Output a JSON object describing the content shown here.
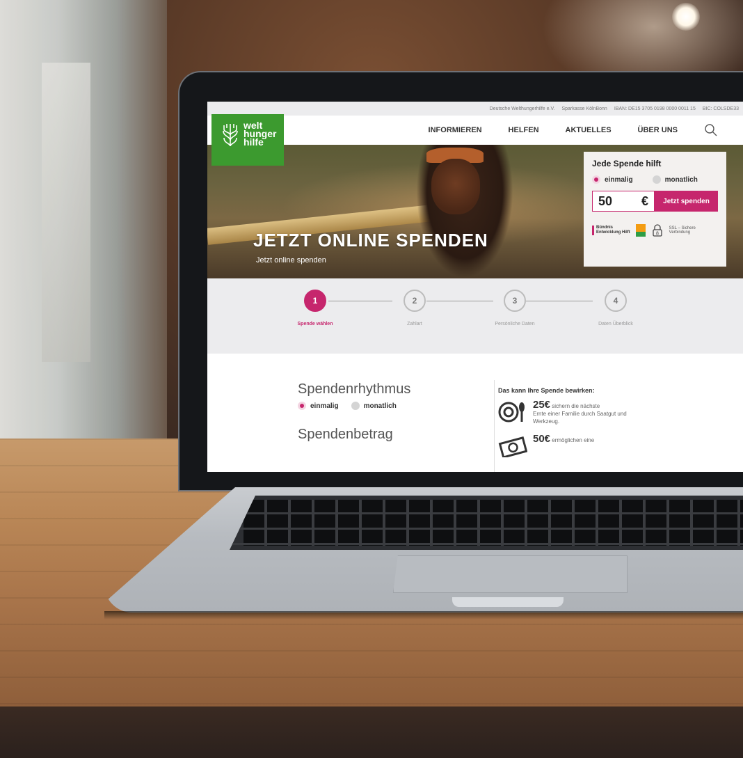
{
  "topbar": {
    "org": "Deutsche Welthungerhilfe e.V.",
    "bank": "Sparkasse KölnBonn",
    "iban": "IBAN: DE15 3705 0198 0000 0011 15",
    "bic": "BIC: COLSDE33"
  },
  "logo": {
    "line1": "welt",
    "line2": "hunger",
    "line3": "hilfe",
    "icon": "wheat-logo-icon"
  },
  "nav": {
    "items": [
      {
        "label": "INFORMIEREN"
      },
      {
        "label": "HELFEN"
      },
      {
        "label": "AKTUELLES"
      },
      {
        "label": "ÜBER UNS"
      }
    ],
    "search_icon": "search-icon"
  },
  "hero": {
    "title": "JETZT ONLINE SPENDEN",
    "subtitle": "Jetzt online spenden"
  },
  "donate_box": {
    "title": "Jede Spende hilft",
    "option_once": "einmalig",
    "option_monthly": "monatlich",
    "selected": "einmalig",
    "amount": "50",
    "currency": "€",
    "button": "Jetzt spenden",
    "buendnis_line1": "Bündnis",
    "buendnis_line2": "Entwicklung Hilft",
    "ssl_line1": "SSL – Sichere",
    "ssl_line2": "Verbindung",
    "lock_number": "8"
  },
  "steps": [
    {
      "number": "1",
      "label": "Spende wählen",
      "active": true
    },
    {
      "number": "2",
      "label": "Zahlart",
      "active": false
    },
    {
      "number": "3",
      "label": "Persönliche Daten",
      "active": false
    },
    {
      "number": "4",
      "label": "Daten Überblick",
      "active": false
    }
  ],
  "content": {
    "rhythm_title": "Spendenrhythmus",
    "rhythm_once": "einmalig",
    "rhythm_monthly": "monatlich",
    "amount_title": "Spendenbetrag",
    "effects_head": "Das kann Ihre Spende bewirken:",
    "effects": [
      {
        "amount": "25€",
        "text_inline": "sichern die nächste",
        "text_rest": "Ernte einer Familie durch Saatgut und Werkzeug.",
        "icon": "plate-cutlery-icon"
      },
      {
        "amount": "50€",
        "text_inline": "ermöglichen eine",
        "text_rest": "",
        "icon": "money-bill-icon"
      }
    ]
  },
  "colors": {
    "accent": "#c6266d",
    "brand_green": "#3c9a2f"
  }
}
